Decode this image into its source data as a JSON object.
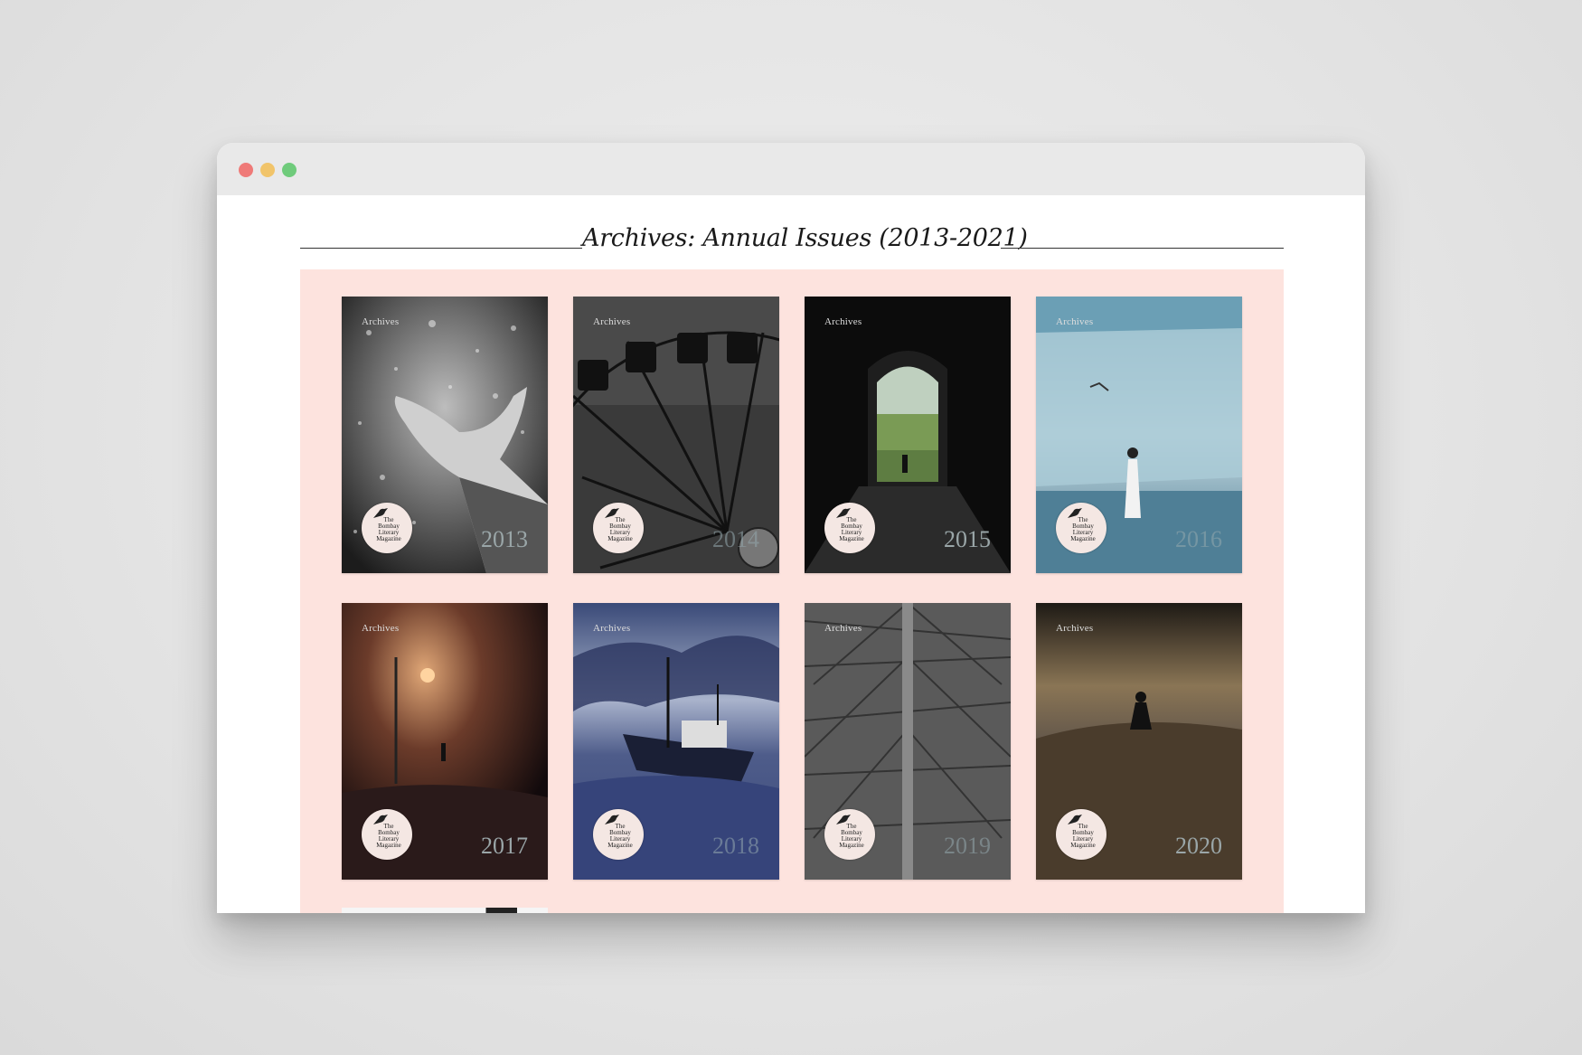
{
  "window": {
    "controls": [
      "close",
      "minimize",
      "maximize"
    ]
  },
  "page": {
    "title": "Archives: Annual Issues (2013-2021)"
  },
  "badge_text": [
    "The",
    "Bombay",
    "Literary",
    "Magazine"
  ],
  "covers": [
    {
      "label": "Archives",
      "year": "2013"
    },
    {
      "label": "Archives",
      "year": "2014"
    },
    {
      "label": "Archives",
      "year": "2015"
    },
    {
      "label": "Archives",
      "year": "2016"
    },
    {
      "label": "Archives",
      "year": "2017"
    },
    {
      "label": "Archives",
      "year": "2018"
    },
    {
      "label": "Archives",
      "year": "2019"
    },
    {
      "label": "Archives",
      "year": "2020"
    }
  ],
  "colors": {
    "panel": "#fde3de",
    "badge": "#f4e7e3"
  }
}
